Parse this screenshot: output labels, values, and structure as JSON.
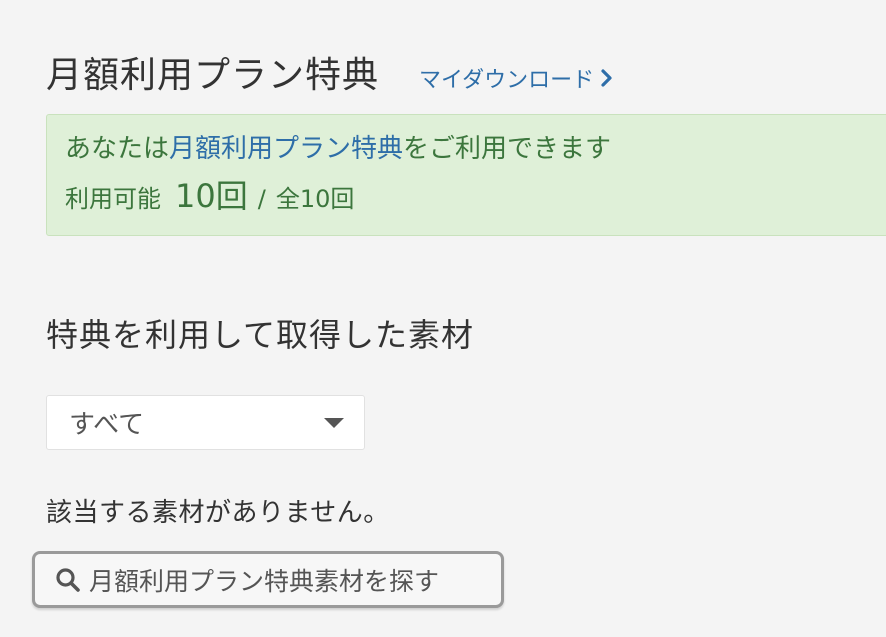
{
  "header": {
    "title": "月額利用プラン特典",
    "my_download_link": "マイダウンロード"
  },
  "alert": {
    "prefix": "あなたは",
    "highlight": "月額利用プラン特典",
    "suffix": "をご利用できます",
    "available_label": "利用可能",
    "available_count": "10回",
    "separator": "/",
    "total": "全10回"
  },
  "section": {
    "title": "特典を利用して取得した素材"
  },
  "filter": {
    "selected": "すべて"
  },
  "empty_message": "該当する素材がありません。",
  "search_button": {
    "label": "月額利用プラン特典素材を探す"
  },
  "colors": {
    "link": "#2e6ea8",
    "alert_bg": "#dff0d8",
    "alert_text": "#3c763d",
    "page_bg": "#f4f4f4"
  },
  "icons": {
    "link_chevron": "chevron-right-icon",
    "select_caret": "caret-down-icon",
    "search": "search-icon"
  }
}
